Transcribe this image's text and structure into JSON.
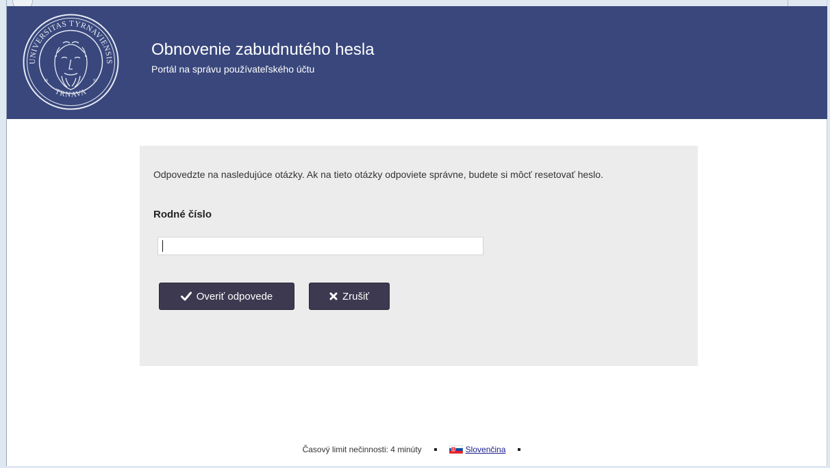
{
  "header": {
    "title": "Obnovenie zabudnutého hesla",
    "subtitle": "Portál na správu používateľského účtu",
    "logo": {
      "icon": "university-seal-icon",
      "text_top": "UNIVERSITAS TYRNAVIENSIS",
      "text_bottom": "TRNAVA"
    }
  },
  "form": {
    "instructions": "Odpovedzte na nasledujúce otázky. Ak na tieto otázky odpoviete správne, budete si môcť resetovať heslo.",
    "field_label": "Rodné číslo",
    "field_value": "",
    "verify_label": "Overiť odpovede",
    "verify_icon": "checkmark-icon",
    "cancel_label": "Zrušiť",
    "cancel_icon": "close-icon"
  },
  "footer": {
    "idle_timeout": "Časový limit nečinnosti: 4 minúty",
    "language": "Slovenčina",
    "language_flag": "slovak-flag-icon"
  },
  "colors": {
    "header_bg": "#39477c",
    "panel_bg": "#ececec",
    "button_bg": "#3d3950"
  }
}
